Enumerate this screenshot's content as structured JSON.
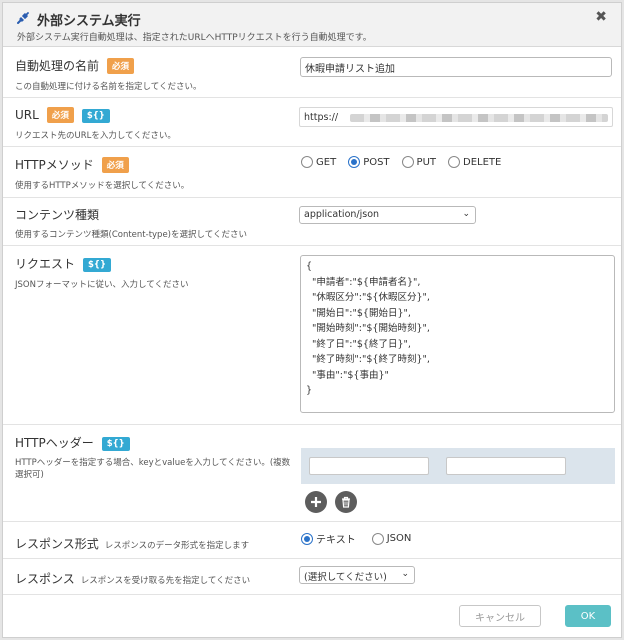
{
  "dialog": {
    "title": "外部システム実行",
    "subtitle": "外部システム実行自動処理は、指定されたURLへHTTPリクエストを行う自動処理です。",
    "close_glyph": "✖"
  },
  "badges": {
    "required": "必須",
    "variable": "${}"
  },
  "fields": {
    "name": {
      "label": "自動処理の名前",
      "description": "この自動処理に付ける名前を指定してください。",
      "value": "休暇申請リスト追加"
    },
    "url": {
      "label": "URL",
      "description": "リクエスト先のURLを入力してください。",
      "value": "https://"
    },
    "method": {
      "label": "HTTPメソッド",
      "description": "使用するHTTPメソッドを選択してください。",
      "options": [
        "GET",
        "POST",
        "PUT",
        "DELETE"
      ],
      "selected": "POST"
    },
    "content_type": {
      "label": "コンテンツ種類",
      "description": "使用するコンテンツ種類(Content-type)を選択してください",
      "value": "application/json"
    },
    "request": {
      "label": "リクエスト",
      "description": "JSONフォーマットに従い、入力してください",
      "body": "{\n  \"申請者\":\"${申請者名}\",\n  \"休暇区分\":\"${休暇区分}\",\n  \"開始日\":\"${開始日}\",\n  \"開始時刻\":\"${開始時刻}\",\n  \"終了日\":\"${終了日}\",\n  \"終了時刻\":\"${終了時刻}\",\n  \"事由\":\"${事由}\"\n}"
    },
    "headers": {
      "label": "HTTPヘッダー",
      "description": "HTTPヘッダーを指定する場合、keyとvalueを入力してください。(複数選択可)"
    },
    "response_format": {
      "label": "レスポンス形式",
      "description": "レスポンスのデータ形式を指定します",
      "options": [
        "テキスト",
        "JSON"
      ],
      "selected": "テキスト"
    },
    "response": {
      "label": "レスポンス",
      "description": "レスポンスを受け取る先を指定してください",
      "value": "(選択してください)"
    }
  },
  "footer": {
    "cancel_label": "キャンセル",
    "ok_label": "OK"
  },
  "colors": {
    "required_badge": "#f0a04b",
    "variable_badge": "#33a9d3",
    "ok_button": "#5bc0c6",
    "radio_checked": "#2a72c9"
  },
  "icons": {
    "title": "plug-icon",
    "add": "plus-icon",
    "delete": "trash-icon",
    "dropdown": "chevron-down-icon"
  }
}
